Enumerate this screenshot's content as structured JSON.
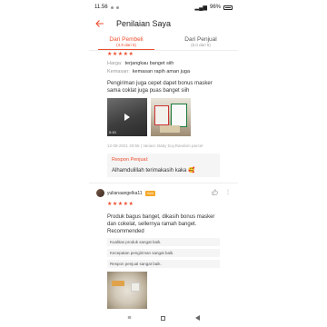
{
  "statusbar": {
    "time": "11.56",
    "battery": "96%"
  },
  "header": {
    "title": "Penilaian Saya"
  },
  "tabs": [
    {
      "label": "Dari Pembeli",
      "sub": "(4.8 dari 5)"
    },
    {
      "label": "Dari Penjual",
      "sub": "(5.0 dari 5)"
    }
  ],
  "review1": {
    "stars": "★★★★★",
    "attrs": [
      {
        "label": "Harga:",
        "value": "terjangkau banget siih"
      },
      {
        "label": "Kemasan:",
        "value": "kemasan rapih aman juga"
      }
    ],
    "body": "Pengiriman juga cepet dapet bonus masker sama coklat juga puas banget siih",
    "video_duration": "0:10",
    "meta": "12-08-2021 20:55 | Variasi: Baby boy,Random parcel",
    "seller_label": "Respon Penjual:",
    "seller_text": "Alhamdulillah terimakasih kaka 🥰"
  },
  "review2": {
    "username": "yulianaangelka11",
    "badge": "Gold",
    "stars": "★★★★★",
    "body": "Produk bagus banget, dikasih bonus masker dan cokelat, sellernya ramah banget. Recommended",
    "chips": [
      "Kualitas produk sangat baik.",
      "Kecepatan pengiriman sangat baik.",
      "Respon penjual sangat baik."
    ]
  },
  "icons": {
    "back": "arrow-left-icon",
    "like": "thumbs-up-icon",
    "more": "more-icon"
  },
  "colors": {
    "accent": "#ee4d2d",
    "badge": "#f5a623"
  }
}
